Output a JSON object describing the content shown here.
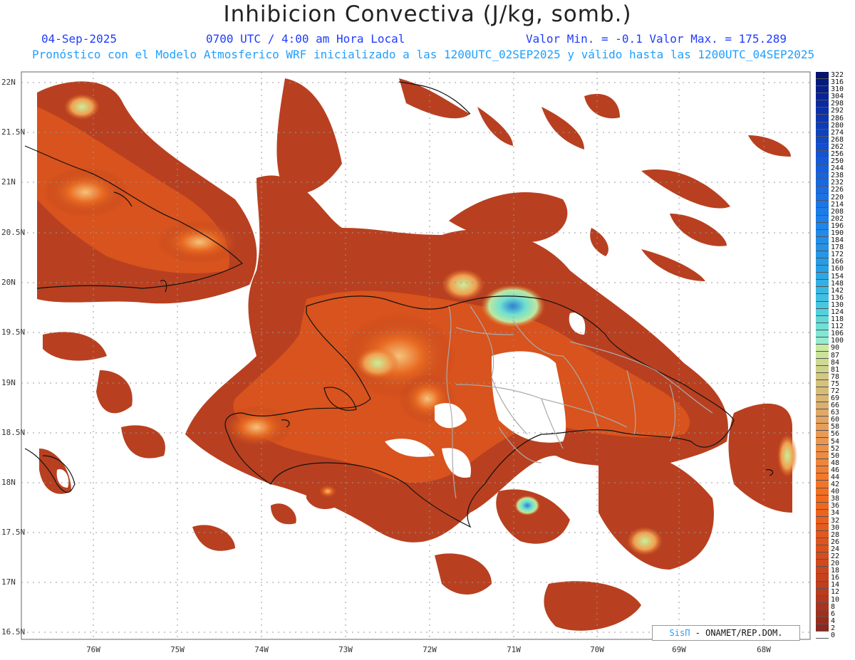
{
  "header": {
    "title": "Inhibicion Convectiva (J/kg, somb.)",
    "date": "04-Sep-2025",
    "time": "0700 UTC / 4:00 am Hora Local",
    "minmax": "Valor Min. = -0.1  Valor Max. = 175.289",
    "subtitle": "Pronóstico con el Modelo Atmosferico WRF inicializado a las 1200UTC_02SEP2025 y válido hasta las  1200UTC_04SEP2025"
  },
  "axes": {
    "lat_labels": [
      "22N",
      "21.5N",
      "21N",
      "20.5N",
      "20N",
      "19.5N",
      "19N",
      "18.5N",
      "18N",
      "17.5N",
      "17N",
      "16.5N"
    ],
    "lon_labels": [
      "76W",
      "75W",
      "74W",
      "73W",
      "72W",
      "71W",
      "70W",
      "69W",
      "68W"
    ]
  },
  "colorbar": {
    "labels": [
      "322",
      "316",
      "310",
      "304",
      "298",
      "292",
      "286",
      "280",
      "274",
      "268",
      "262",
      "256",
      "250",
      "244",
      "238",
      "232",
      "226",
      "220",
      "214",
      "208",
      "202",
      "196",
      "190",
      "184",
      "178",
      "172",
      "166",
      "160",
      "154",
      "148",
      "142",
      "136",
      "130",
      "124",
      "118",
      "112",
      "106",
      "100",
      "90",
      "87",
      "84",
      "81",
      "78",
      "75",
      "72",
      "69",
      "66",
      "63",
      "60",
      "58",
      "56",
      "54",
      "52",
      "50",
      "48",
      "46",
      "44",
      "42",
      "40",
      "38",
      "36",
      "34",
      "32",
      "30",
      "28",
      "26",
      "24",
      "22",
      "20",
      "18",
      "16",
      "14",
      "12",
      "10",
      "8",
      "6",
      "4",
      "2",
      "0"
    ]
  },
  "credit": {
    "brand": "SisΠ",
    "text": " - ONAMET/REP.DOM."
  }
}
